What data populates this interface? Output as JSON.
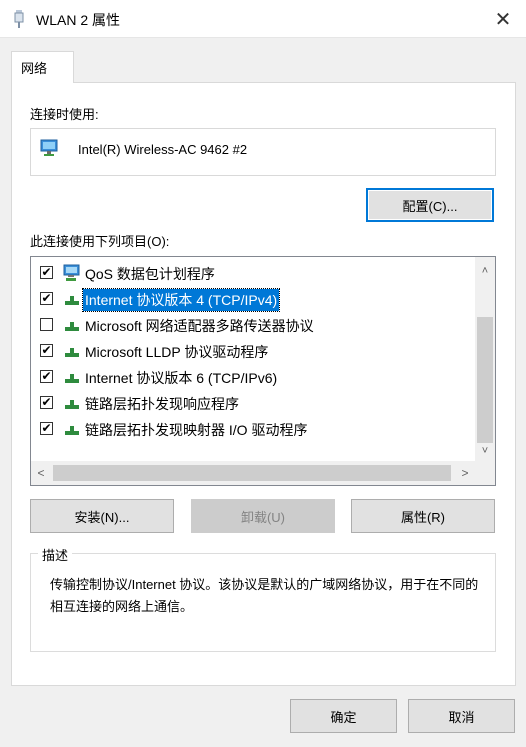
{
  "window": {
    "title": "WLAN 2 属性",
    "close_glyph": "✕"
  },
  "tabs": [
    {
      "label": "网络"
    }
  ],
  "connect_using": {
    "label": "连接时使用:",
    "adapter_name": "Intel(R) Wireless-AC 9462 #2",
    "icon": "network-adapter-icon"
  },
  "configure_button": "配置(C)...",
  "items_label": "此连接使用下列项目(O):",
  "items": [
    {
      "label": "QoS 数据包计划程序",
      "checked": true,
      "selected": false,
      "icon": "qos-service-icon"
    },
    {
      "label": "Internet 协议版本 4 (TCP/IPv4)",
      "checked": true,
      "selected": true,
      "icon": "protocol-icon"
    },
    {
      "label": "Microsoft 网络适配器多路传送器协议",
      "checked": false,
      "selected": false,
      "icon": "protocol-icon"
    },
    {
      "label": "Microsoft LLDP 协议驱动程序",
      "checked": true,
      "selected": false,
      "icon": "protocol-icon"
    },
    {
      "label": "Internet 协议版本 6 (TCP/IPv6)",
      "checked": true,
      "selected": false,
      "icon": "protocol-icon"
    },
    {
      "label": "链路层拓扑发现响应程序",
      "checked": true,
      "selected": false,
      "icon": "protocol-icon"
    },
    {
      "label": "链路层拓扑发现映射器 I/O 驱动程序",
      "checked": true,
      "selected": false,
      "icon": "protocol-icon"
    }
  ],
  "scroll": {
    "up": "˄",
    "down": "˅",
    "left": "<",
    "right": ">"
  },
  "buttons": {
    "install": "安装(N)...",
    "uninstall": "卸载(U)",
    "properties": "属性(R)"
  },
  "description": {
    "title": "描述",
    "text": "传输控制协议/Internet 协议。该协议是默认的广域网络协议，用于在不同的相互连接的网络上通信。"
  },
  "footer": {
    "ok": "确定",
    "cancel": "取消"
  },
  "colors": {
    "selection": "#0078d7",
    "window_bg": "#f0f0f0"
  }
}
